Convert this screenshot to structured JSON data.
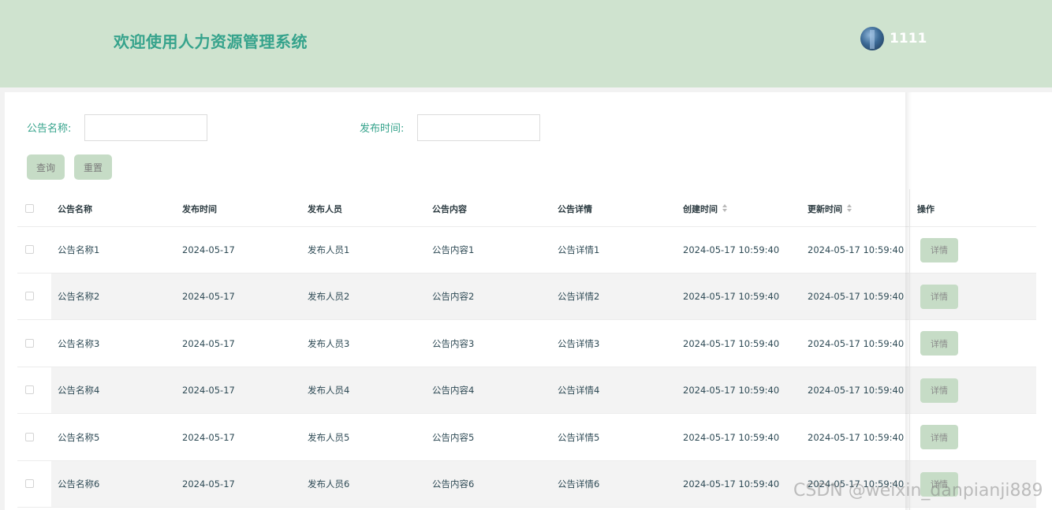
{
  "header": {
    "title": "欢迎使用人力资源管理系统",
    "username": "1111"
  },
  "search": {
    "name_label": "公告名称:",
    "name_value": "",
    "time_label": "发布时间:",
    "time_value": "",
    "query_label": "查询",
    "reset_label": "重置"
  },
  "table": {
    "columns": [
      "公告名称",
      "发布时间",
      "发布人员",
      "公告内容",
      "公告详情",
      "创建时间",
      "更新时间",
      "操作"
    ],
    "rows": [
      {
        "name": "公告名称1",
        "date": "2024-05-17",
        "publisher": "发布人员1",
        "content": "公告内容1",
        "detail": "公告详情1",
        "created": "2024-05-17 10:59:40",
        "updated": "2024-05-17 10:59:40",
        "action": "详情"
      },
      {
        "name": "公告名称2",
        "date": "2024-05-17",
        "publisher": "发布人员2",
        "content": "公告内容2",
        "detail": "公告详情2",
        "created": "2024-05-17 10:59:40",
        "updated": "2024-05-17 10:59:40",
        "action": "详情"
      },
      {
        "name": "公告名称3",
        "date": "2024-05-17",
        "publisher": "发布人员3",
        "content": "公告内容3",
        "detail": "公告详情3",
        "created": "2024-05-17 10:59:40",
        "updated": "2024-05-17 10:59:40",
        "action": "详情"
      },
      {
        "name": "公告名称4",
        "date": "2024-05-17",
        "publisher": "发布人员4",
        "content": "公告内容4",
        "detail": "公告详情4",
        "created": "2024-05-17 10:59:40",
        "updated": "2024-05-17 10:59:40",
        "action": "详情"
      },
      {
        "name": "公告名称5",
        "date": "2024-05-17",
        "publisher": "发布人员5",
        "content": "公告内容5",
        "detail": "公告详情5",
        "created": "2024-05-17 10:59:40",
        "updated": "2024-05-17 10:59:40",
        "action": "详情"
      },
      {
        "name": "公告名称6",
        "date": "2024-05-17",
        "publisher": "发布人员6",
        "content": "公告内容6",
        "detail": "公告详情6",
        "created": "2024-05-17 10:59:40",
        "updated": "2024-05-17 10:59:40",
        "action": "详情"
      }
    ]
  },
  "watermark": "CSDN @weixin_danpianji889",
  "colors": {
    "header_bg": "#cfe3cf",
    "accent": "#36a38c",
    "button_bg": "#c6dcc6"
  },
  "icons": {
    "avatar": "avatar-image",
    "sort": "sort-caret-icon",
    "checkbox": "checkbox-icon"
  }
}
